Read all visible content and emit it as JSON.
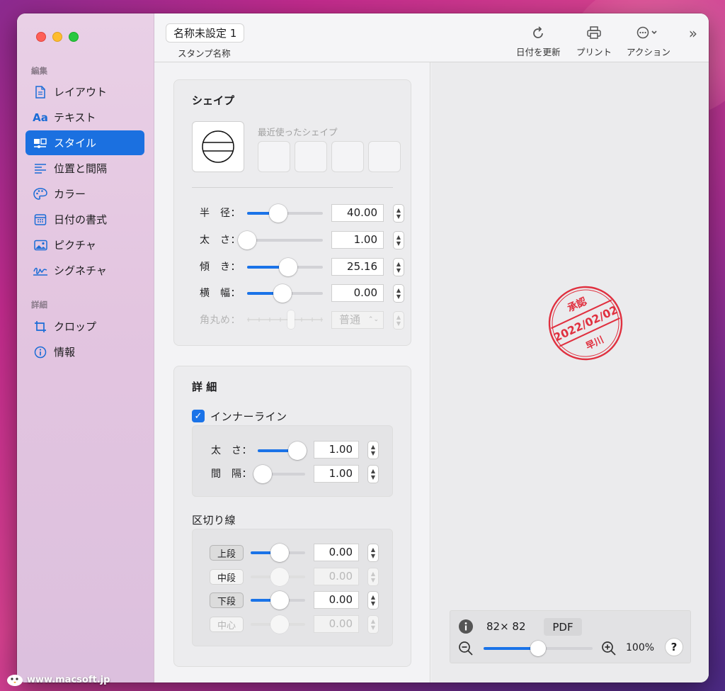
{
  "window": {
    "title": "名称未設定 1",
    "subtitle": "スタンプ名称"
  },
  "toolbar": {
    "refresh_label": "日付を更新",
    "print_label": "プリント",
    "action_label": "アクション",
    "more_glyph": "»"
  },
  "sidebar": {
    "section_edit": "編集",
    "section_detail": "詳細",
    "items": [
      {
        "label": "レイアウト",
        "icon": "document-icon"
      },
      {
        "label": "テキスト",
        "icon": "text-aa-icon"
      },
      {
        "label": "スタイル",
        "icon": "style-icon",
        "active": true
      },
      {
        "label": "位置と間隔",
        "icon": "align-icon"
      },
      {
        "label": "カラー",
        "icon": "palette-icon"
      },
      {
        "label": "日付の書式",
        "icon": "calendar-icon"
      },
      {
        "label": "ピクチャ",
        "icon": "photo-icon"
      },
      {
        "label": "シグネチャ",
        "icon": "signature-icon"
      }
    ],
    "detail_items": [
      {
        "label": "クロップ",
        "icon": "crop-icon"
      },
      {
        "label": "情報",
        "icon": "info-icon"
      }
    ]
  },
  "shape_panel": {
    "title": "シェイプ",
    "recent_label": "最近使ったシェイプ",
    "rows": [
      {
        "label": "半　径：",
        "value": "40.00",
        "fill": 0.41
      },
      {
        "label": "太　さ：",
        "value": "1.00",
        "fill": 0.0
      },
      {
        "label": "傾　き：",
        "value": "25.16",
        "fill": 0.54
      },
      {
        "label": "横　幅：",
        "value": "0.00",
        "fill": 0.47
      },
      {
        "label": "角丸め：",
        "value": "普通",
        "fill": 0.5,
        "disabled": true
      }
    ]
  },
  "detail_panel": {
    "title": "詳 細",
    "inner_line_label": "インナーライン",
    "inner_line_checked": true,
    "inner_rows": [
      {
        "label": "太　さ：",
        "value": "1.00",
        "fill": 0.84
      },
      {
        "label": "間　隔：",
        "value": "1.00",
        "fill": 0.1
      }
    ],
    "separator_title": "区切り線",
    "separator_rows": [
      {
        "label": "上段",
        "value": "0.00",
        "fill": 0.53
      },
      {
        "label": "中段",
        "value": "0.00",
        "fill": 0.53,
        "disabled": true
      },
      {
        "label": "下段",
        "value": "0.00",
        "fill": 0.53
      },
      {
        "label": "中心",
        "value": "0.00",
        "fill": 0.53,
        "disabled": true
      }
    ]
  },
  "stamp": {
    "top": "承認",
    "date": "2022/02/02",
    "bottom": "早川",
    "color": "#e0303f"
  },
  "info_bar": {
    "size": "82× 82",
    "format": "PDF",
    "zoom": "100%",
    "zoom_fill": 0.5,
    "help": "?"
  },
  "watermark": "www.macsoft.jp",
  "colors": {
    "accent": "#1a73e8",
    "sidebar_active": "#1b70e0",
    "stamp_red": "#e0303f"
  }
}
